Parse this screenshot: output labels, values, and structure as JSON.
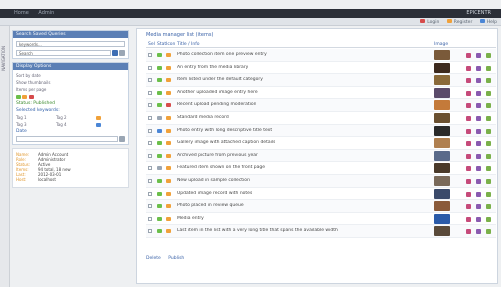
{
  "topbar": {
    "nav": [
      "Home",
      "Admin"
    ],
    "brand": "EPICENTR"
  },
  "subbar": {
    "links": [
      "Login",
      "Register",
      "Help"
    ]
  },
  "vstrip": {
    "label": "NAVIGATION"
  },
  "sidebar": {
    "search_panel": {
      "title": "Search Saved Queries",
      "query_placeholder": "keywords...",
      "filter_value": "Search"
    },
    "filter_panel": {
      "title": "Display Options",
      "lines": [
        "Sort by date",
        "Show thumbnails",
        "Items per page"
      ],
      "status_label": "Status: Published",
      "categories_title": "Selected keywords:",
      "cat_items": [
        "Tag 1",
        "Tag 2",
        "Tag 3",
        "Tag 4"
      ],
      "date_label": "Date"
    },
    "info": [
      {
        "k": "Name:",
        "v": "Admin Account"
      },
      {
        "k": "Role:",
        "v": "Administrator"
      },
      {
        "k": "Status:",
        "v": "Active"
      },
      {
        "k": "Items:",
        "v": "94 total, 18 new"
      },
      {
        "k": "Last:",
        "v": "2012-03-01"
      },
      {
        "k": "Host:",
        "v": "localhost"
      }
    ]
  },
  "main": {
    "title": "Media manager list (items)",
    "headers": {
      "sel": "Sel",
      "stat": "Stat",
      "type": "Icon",
      "title": "Title / Info",
      "img": "Image"
    },
    "rows": [
      {
        "title": "Photo collection item one preview entry",
        "st": "#6bbf4b",
        "ic": "#f0a13a",
        "th": "#7a5a3a"
      },
      {
        "title": "An entry from the media library",
        "st": "#6bbf4b",
        "ic": "#f0a13a",
        "th": "#3d2a1e"
      },
      {
        "title": "Item listed under the default category",
        "st": "#6bbf4b",
        "ic": "#f0a13a",
        "th": "#8a6a3a"
      },
      {
        "title": "Another uploaded image entry here",
        "st": "#6bbf4b",
        "ic": "#f0a13a",
        "th": "#5a4a6a"
      },
      {
        "title": "Recent upload pending moderation",
        "st": "#6bbf4b",
        "ic": "#d64b4b",
        "th": "#c47a3a"
      },
      {
        "title": "Standard media record",
        "st": "#9aa6b4",
        "ic": "#f0a13a",
        "th": "#6a5030"
      },
      {
        "title": "Photo entry with long descriptive title text",
        "st": "#4b86d6",
        "ic": "#f0a13a",
        "th": "#2a2a2a"
      },
      {
        "title": "Gallery image with attached caption details",
        "st": "#6bbf4b",
        "ic": "#f0a13a",
        "th": "#b08050"
      },
      {
        "title": "Archived picture from previous year",
        "st": "#6bbf4b",
        "ic": "#f0a13a",
        "th": "#5a6a8a"
      },
      {
        "title": "Featured item shown on the front page",
        "st": "#9aa6b4",
        "ic": "#f0a13a",
        "th": "#4a3a2a"
      },
      {
        "title": "New upload in sample collection",
        "st": "#6bbf4b",
        "ic": "#f0a13a",
        "th": "#7a6a5a"
      },
      {
        "title": "Updated image record with notes",
        "st": "#6bbf4b",
        "ic": "#f0a13a",
        "th": "#3a4a6a"
      },
      {
        "title": "Photo placed in review queue",
        "st": "#6bbf4b",
        "ic": "#f0a13a",
        "th": "#8a5a3a"
      },
      {
        "title": "Media entry",
        "st": "#6bbf4b",
        "ic": "#f0a13a",
        "th": "#2a5aa8"
      },
      {
        "title": "Last item in the list with a very long title that spans the available width",
        "st": "#6bbf4b",
        "ic": "#f0a13a",
        "th": "#5a4a3a"
      }
    ],
    "footer": [
      "Delete",
      "Publish"
    ]
  }
}
